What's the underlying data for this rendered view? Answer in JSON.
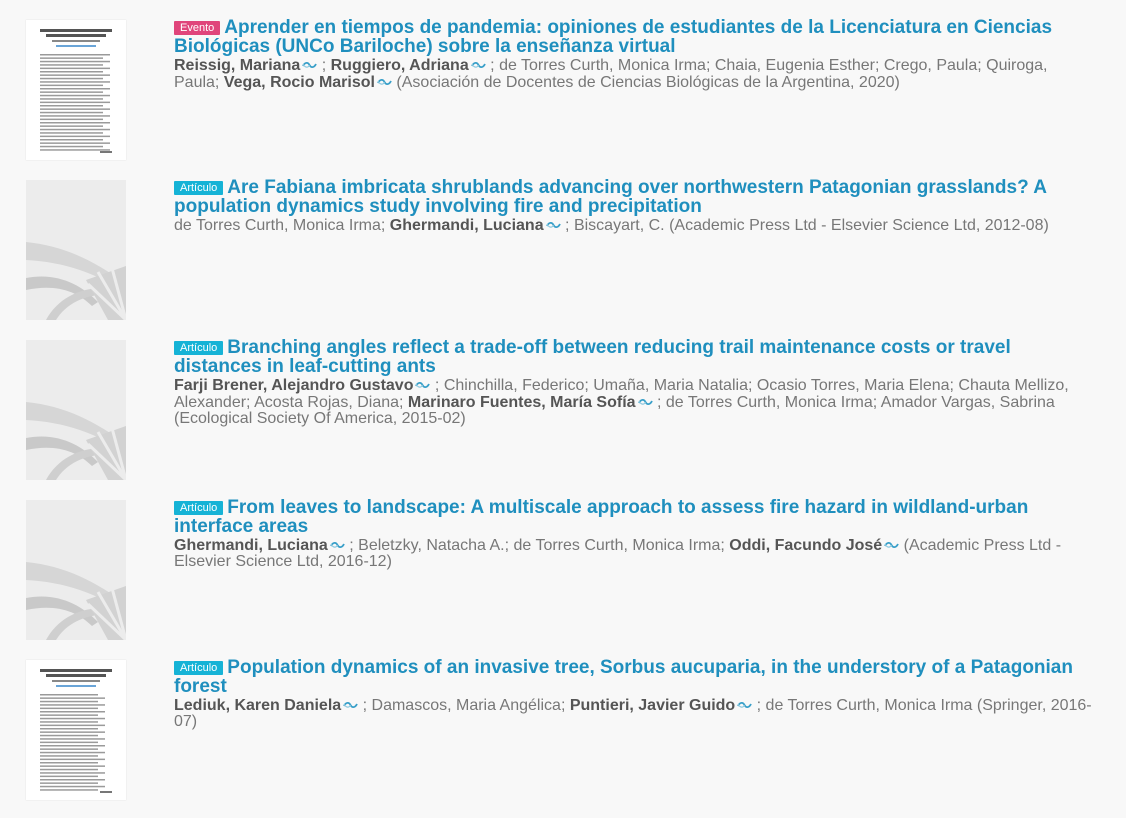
{
  "colors": {
    "title": "#1f8fbe",
    "badge_evento": "#e0457b",
    "badge_articulo": "#16b3d6",
    "author_text": "#777777",
    "author_highlight": "#555555",
    "background": "#f8f8f8",
    "icon_accent": "#3aa0c9"
  },
  "results": [
    {
      "badge": "Evento",
      "badge_type": "evento",
      "title": "Aprender en tiempos de pandemia: opiniones de estudiantes de la Licenciatura en Ciencias Biológicas (UNCo Bariloche) sobre la enseñanza virtual",
      "thumbnail": "document-preview",
      "authors": [
        {
          "name": "Reissig, Mariana",
          "highlight": true,
          "icon": "cic-author-icon"
        },
        {
          "name": "Ruggiero, Adriana",
          "highlight": true,
          "icon": "cic-author-icon"
        },
        {
          "name": "de Torres Curth, Monica Irma",
          "highlight": false
        },
        {
          "name": "Chaia, Eugenia Esther",
          "highlight": false
        },
        {
          "name": "Crego, Paula",
          "highlight": false
        },
        {
          "name": "Quiroga, Paula",
          "highlight": false
        },
        {
          "name": "Vega, Rocio Marisol",
          "highlight": true,
          "icon": "cic-author-icon"
        }
      ],
      "source": "(Asociación de Docentes de Ciencias Biológicas de la Argentina, 2020)"
    },
    {
      "badge": "Artículo",
      "badge_type": "articulo",
      "title": "Are Fabiana imbricata shrublands advancing over northwestern Patagonian grasslands? A population dynamics study involving fire and precipitation",
      "thumbnail": "placeholder-logo",
      "authors": [
        {
          "name": "de Torres Curth, Monica Irma",
          "highlight": false
        },
        {
          "name": "Ghermandi, Luciana",
          "highlight": true,
          "icon": "cic-author-icon"
        },
        {
          "name": "Biscayart, C.",
          "highlight": false
        }
      ],
      "source": "(Academic Press Ltd - Elsevier Science Ltd, 2012-08)"
    },
    {
      "badge": "Artículo",
      "badge_type": "articulo",
      "title": "Branching angles reflect a trade-off between reducing trail maintenance costs or travel distances in leaf-cutting ants",
      "thumbnail": "placeholder-logo",
      "authors": [
        {
          "name": "Farji Brener, Alejandro Gustavo",
          "highlight": true,
          "icon": "cic-author-icon"
        },
        {
          "name": "Chinchilla, Federico",
          "highlight": false
        },
        {
          "name": "Umaña, Maria Natalia",
          "highlight": false
        },
        {
          "name": "Ocasio Torres, Maria Elena",
          "highlight": false
        },
        {
          "name": "Chauta Mellizo, Alexander",
          "highlight": false
        },
        {
          "name": "Acosta Rojas, Diana",
          "highlight": false
        },
        {
          "name": "Marinaro Fuentes, María Sofía",
          "highlight": true,
          "icon": "cic-author-icon"
        },
        {
          "name": "de Torres Curth, Monica Irma",
          "highlight": false
        },
        {
          "name": "Amador Vargas, Sabrina",
          "highlight": false
        }
      ],
      "source": "(Ecological Society Of America, 2015-02)"
    },
    {
      "badge": "Artículo",
      "badge_type": "articulo",
      "title": "From leaves to landscape: A multiscale approach to assess fire hazard in wildland-urban interface areas",
      "thumbnail": "placeholder-logo",
      "authors": [
        {
          "name": "Ghermandi, Luciana",
          "highlight": true,
          "icon": "cic-author-icon"
        },
        {
          "name": "Beletzky, Natacha A.",
          "highlight": false
        },
        {
          "name": "de Torres Curth, Monica Irma",
          "highlight": false
        },
        {
          "name": "Oddi, Facundo José",
          "highlight": true,
          "icon": "cic-author-icon"
        }
      ],
      "source": "(Academic Press Ltd - Elsevier Science Ltd, 2016-12)"
    },
    {
      "badge": "Artículo",
      "badge_type": "articulo",
      "title": "Population dynamics of an invasive tree, Sorbus aucuparia, in the understory of a Patagonian forest",
      "thumbnail": "document-preview",
      "authors": [
        {
          "name": "Lediuk, Karen Daniela",
          "highlight": true,
          "icon": "cic-author-icon"
        },
        {
          "name": "Damascos, Maria Angélica",
          "highlight": false
        },
        {
          "name": "Puntieri, Javier Guido",
          "highlight": true,
          "icon": "cic-author-icon"
        },
        {
          "name": "de Torres Curth, Monica Irma",
          "highlight": false
        }
      ],
      "source": "(Springer, 2016-07)"
    }
  ]
}
